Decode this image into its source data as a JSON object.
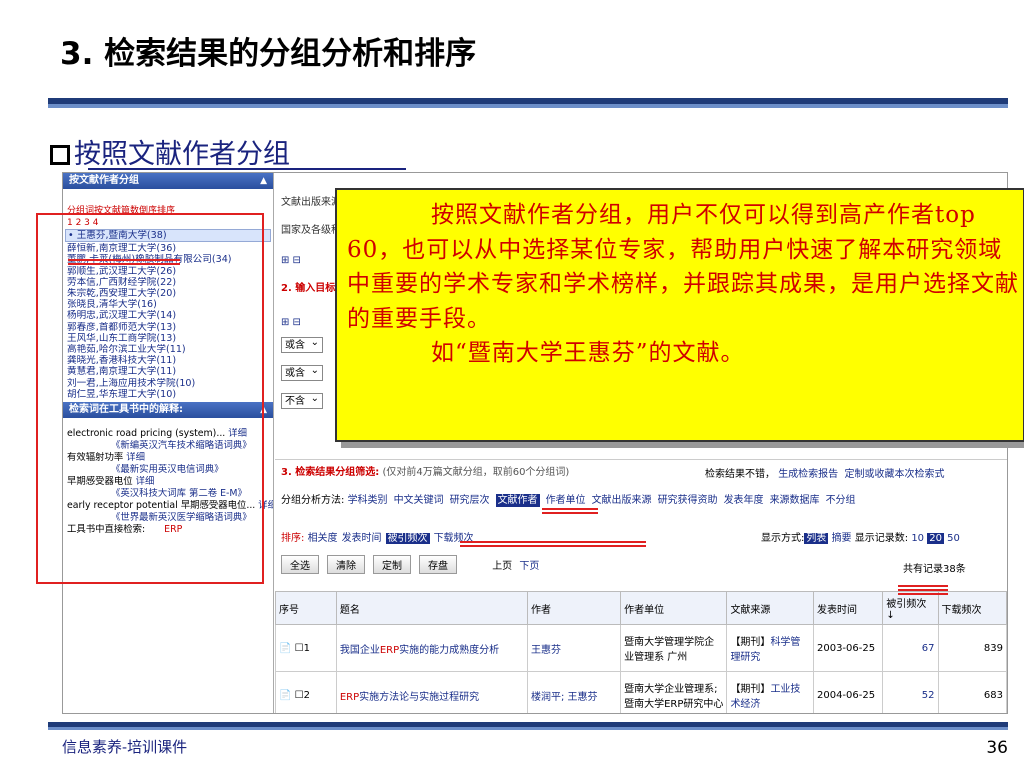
{
  "slide": {
    "title": "3. 检索结果的分组分析和排序",
    "subtitle": "按照文献作者分组",
    "footer": "信息素养-培训课件",
    "page_number": "36"
  },
  "callout": {
    "line1": "按照文献作者分组，用户不仅可以得到高产作者top 60，也可以从中选择某位专家，帮助用户快速了解本研究领域中重要的学术专家和学术榜样，并跟踪其成果，是用户选择文献的重要手段。",
    "line2": "如“暨南大学王惠芬”的文献。"
  },
  "left_panel": {
    "header": "按文献作者分组",
    "group_link": "分组词按文献篇数倒序排序",
    "pages": "1 2 3 4",
    "authors": [
      "• 王惠芬,暨南大学(38)",
      "薛恒新,南京理工大学(36)",
      "董鹏,卡莱(梅州)橡胶制品有限公司(34)",
      "郭顺生,武汉理工大学(26)",
      "劳本信,广西财经学院(22)",
      "朱宗乾,西安理工大学(20)",
      "张晓良,清华大学(16)",
      "杨明忠,武汉理工大学(14)",
      "郭春彦,首都师范大学(13)",
      "王风华,山东工商学院(13)",
      "高艳茹,哈尔滨工业大学(11)",
      "龚晓光,香港科技大学(11)",
      "黄慧君,南京理工大学(11)",
      "刘一君,上海应用技术学院(10)",
      "胡仁昱,华东理工大学(10)"
    ],
    "tool_header": "检索词在工具书中的解释:",
    "tool_entries": [
      {
        "text": "electronic road pricing (system)...",
        "link": "详细",
        "src": "《新编英汉汽车技术缩略语词典》"
      },
      {
        "text": "有效辐射功率",
        "link": "详细",
        "src": "《最新实用英汉电信词典》"
      },
      {
        "text": "早期感受器电位",
        "link": "详细",
        "src": "《英汉科技大词库 第二卷 E-M》"
      },
      {
        "text": "early receptor potential 早期感受器电位...",
        "link": "详细",
        "src": "《世界最新英汉医学缩略语词典》"
      }
    ],
    "tool_footer_label": "工具书中直接检索:",
    "tool_footer_value": "ERP"
  },
  "search_form": {
    "row1": "文献出版来源",
    "row2": "国家及各级科研项目",
    "step2": "2. 输入目标文献内容特征",
    "selects": [
      "或含",
      "或含",
      "不含"
    ]
  },
  "group_filter": {
    "label": "3. 检索结果分组筛选:",
    "hint": "(仅对前4万篇文献分组，取前60个分组词)",
    "right_text": "检索结果不错，",
    "right_link1": "生成检索报告",
    "right_link2": "定制或收藏本次检索式"
  },
  "group_methods": {
    "label": "分组分析方法:",
    "items": [
      "学科类别",
      "中文关键词",
      "研究层次",
      "文献作者",
      "作者单位",
      "文献出版来源",
      "研究获得资助",
      "发表年度",
      "来源数据库",
      "不分组"
    ],
    "active_index": 3
  },
  "sort": {
    "label": "排序:",
    "items": [
      "相关度",
      "发表时间",
      "被引频次",
      "下载频次"
    ],
    "active_index": 2
  },
  "display": {
    "mode_label": "显示方式:",
    "mode_list": "列表",
    "mode_summary": "摘要",
    "count_label": "显示记录数:",
    "counts": [
      "10",
      "20",
      "50"
    ],
    "active_count": "20"
  },
  "buttons": [
    "全选",
    "清除",
    "定制",
    "存盘"
  ],
  "paging": {
    "prev": "上页",
    "next": "下页"
  },
  "total": "共有记录38条",
  "table": {
    "headers": [
      "序号",
      "题名",
      "作者",
      "作者单位",
      "文献来源",
      "发表时间",
      "被引频次 ↓",
      "下载频次"
    ],
    "rows": [
      {
        "no": "1",
        "title_pre": "我国企业",
        "title_erp": "ERP",
        "title_post": "实施的能力成熟度分析",
        "author": "王惠芬",
        "org": "暨南大学管理学院企业管理系 广州",
        "source_tag": "【期刊】",
        "source": "科学管理研究",
        "date": "2003-06-25",
        "cited": "67",
        "downloads": "839"
      },
      {
        "no": "2",
        "title_pre": "",
        "title_erp": "ERP",
        "title_post": "实施方法论与实施过程研究",
        "author": "楼润平; 王惠芬",
        "org": "暨南大学企业管理系;暨南大学ERP研究中心",
        "source_tag": "【期刊】",
        "source": "工业技术经济",
        "date": "2004-06-25",
        "cited": "52",
        "downloads": "683"
      }
    ]
  },
  "colors": {
    "accent_red": "#e02020",
    "callout_bg": "#ffff00",
    "callout_text": "#d00000",
    "link_blue": "#1a2f8a",
    "rule_blue": "#1f3b78"
  }
}
